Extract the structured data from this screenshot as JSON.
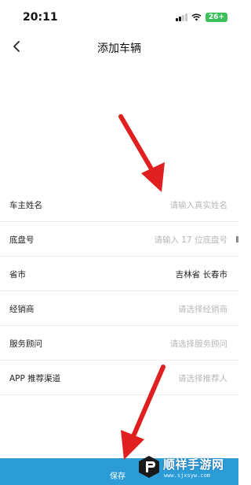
{
  "status_bar": {
    "time": "20:11",
    "battery": "26+",
    "icons": [
      "signal-icon",
      "wifi-icon",
      "battery-icon"
    ]
  },
  "nav": {
    "back_icon": "chevron-left-icon",
    "title": "添加车辆"
  },
  "form": {
    "fields": [
      {
        "label": "车主姓名",
        "value": "请输入真实姓名",
        "filled": false
      },
      {
        "label": "底盘号",
        "value": "请输入 17 位底盘号",
        "filled": false
      },
      {
        "label": "省市",
        "value": "吉林省 长春市",
        "filled": true
      },
      {
        "label": "经销商",
        "value": "请选择经销商",
        "filled": false
      },
      {
        "label": "服务顾问",
        "value": "请选择服务顾问",
        "filled": false
      },
      {
        "label": "APP 推荐渠道",
        "value": "请选择推荐人",
        "filled": false
      }
    ]
  },
  "footer": {
    "save_label": "保存"
  },
  "colors": {
    "accent": "#2c9cd7",
    "arrow": "#e02020",
    "placeholder": "#b8b8b8",
    "battery": "#3cc05a"
  },
  "watermark": {
    "title": "顺祥手游网",
    "url": "www.sjxsyw.com"
  }
}
